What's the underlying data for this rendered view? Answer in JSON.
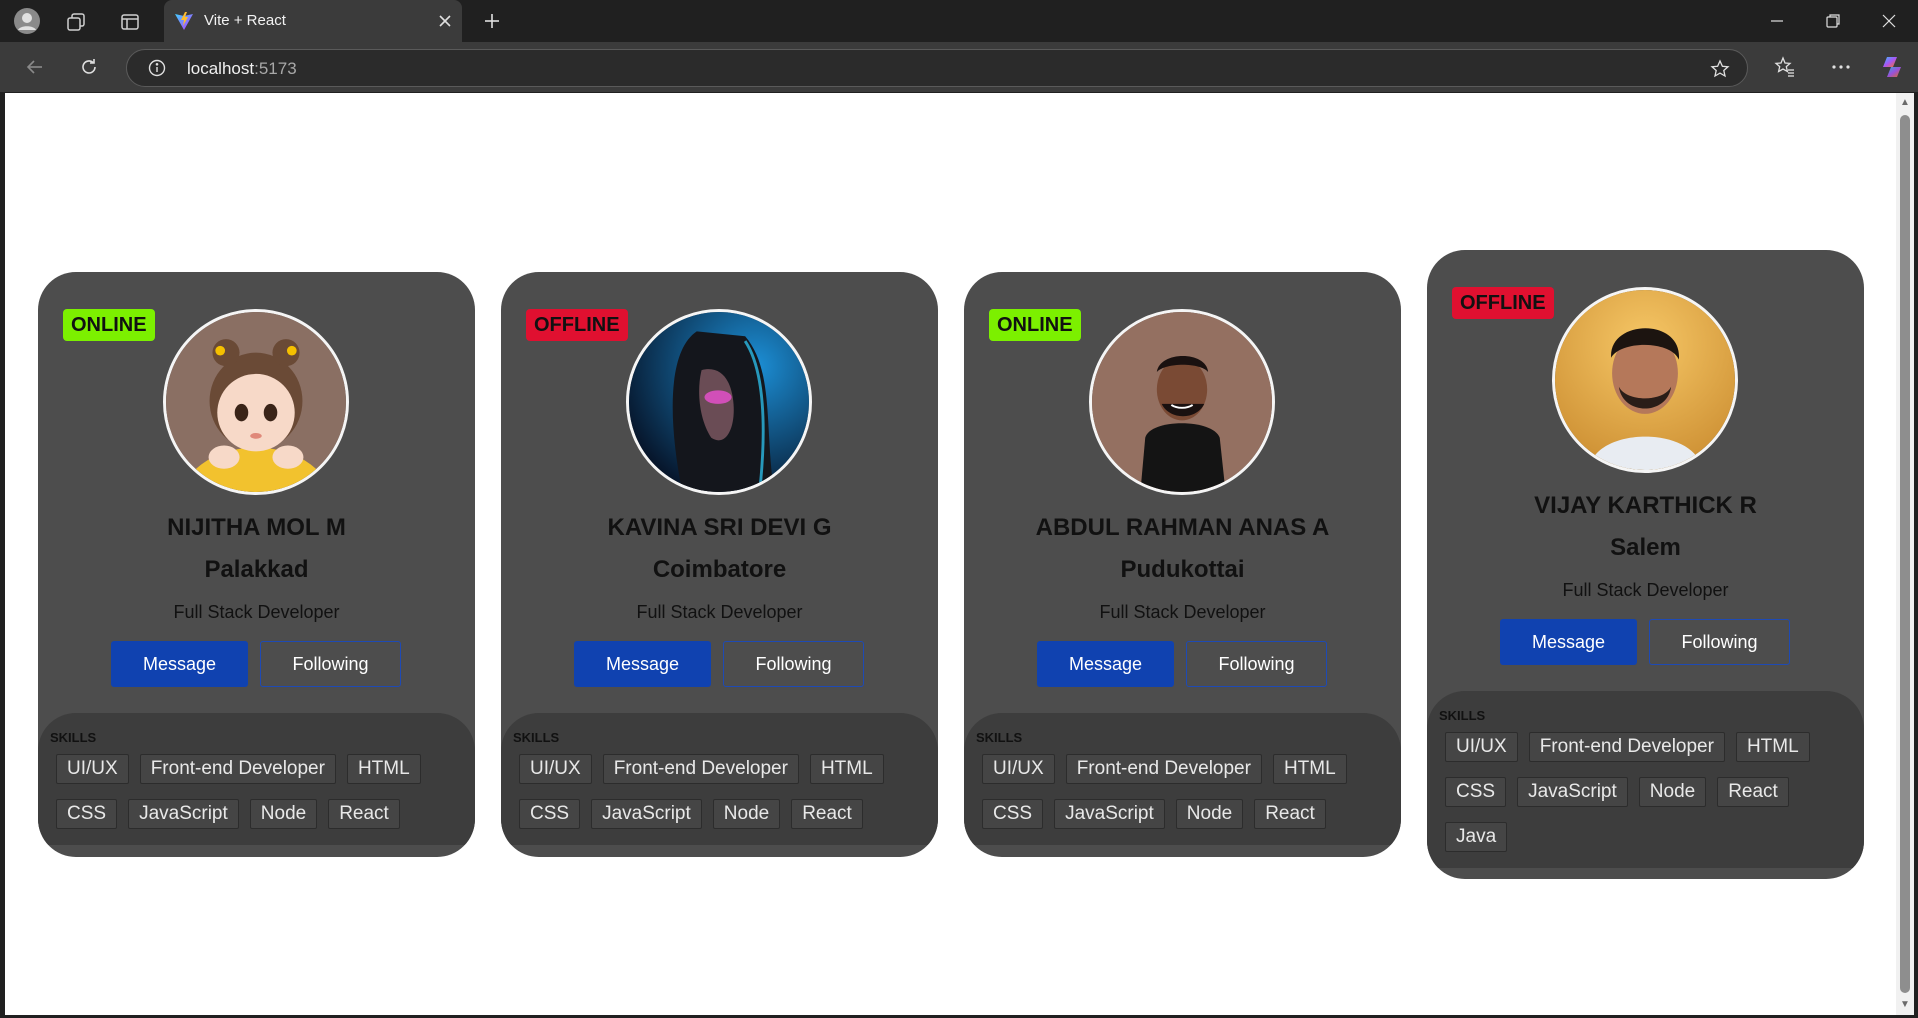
{
  "browser": {
    "tab_title": "Vite + React",
    "url_host": "localhost",
    "url_port": ":5173"
  },
  "cards": [
    {
      "status": "ONLINE",
      "status_color": "#7cf000",
      "name": "NIJITHA MOL M",
      "city": "Palakkad",
      "role": "Full Stack Developer",
      "message_label": "Message",
      "following_label": "Following",
      "skills_title": "SKILLS",
      "skills": [
        "UI/UX",
        "Front-end Developer",
        "HTML",
        "CSS",
        "JavaScript",
        "Node",
        "React"
      ]
    },
    {
      "status": "OFFLINE",
      "status_color": "#e01030",
      "name": "KAVINA SRI DEVI G",
      "city": "Coimbatore",
      "role": "Full Stack Developer",
      "message_label": "Message",
      "following_label": "Following",
      "skills_title": "SKILLS",
      "skills": [
        "UI/UX",
        "Front-end Developer",
        "HTML",
        "CSS",
        "JavaScript",
        "Node",
        "React"
      ]
    },
    {
      "status": "ONLINE",
      "status_color": "#7cf000",
      "name": "ABDUL RAHMAN ANAS A",
      "city": "Pudukottai",
      "role": "Full Stack Developer",
      "message_label": "Message",
      "following_label": "Following",
      "skills_title": "SKILLS",
      "skills": [
        "UI/UX",
        "Front-end Developer",
        "HTML",
        "CSS",
        "JavaScript",
        "Node",
        "React"
      ]
    },
    {
      "status": "OFFLINE",
      "status_color": "#e01030",
      "name": "VIJAY KARTHICK R",
      "city": "Salem",
      "role": "Full Stack Developer",
      "message_label": "Message",
      "following_label": "Following",
      "skills_title": "SKILLS",
      "skills": [
        "UI/UX",
        "Front-end Developer",
        "HTML",
        "CSS",
        "JavaScript",
        "Node",
        "React",
        "Java"
      ]
    }
  ]
}
